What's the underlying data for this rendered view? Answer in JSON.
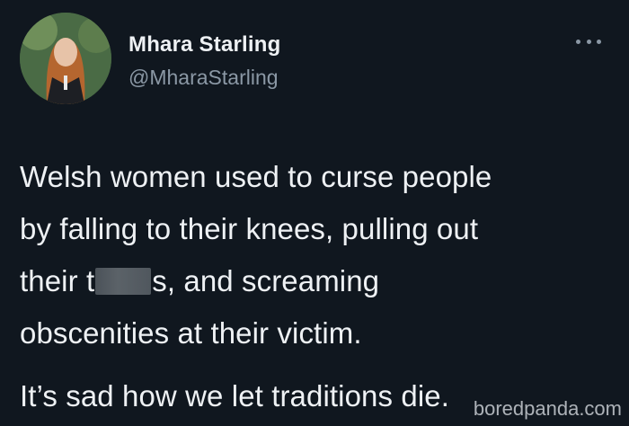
{
  "user": {
    "display_name": "Mhara Starling",
    "handle": "@MharaStarling"
  },
  "menu": {
    "icon": "more-horizontal-icon"
  },
  "tweet": {
    "line1": "Welsh women used to curse people",
    "line2": "by falling to their knees, pulling out",
    "line3_before": "their t",
    "line3_after": "s, and screaming",
    "line4": "obscenities at their victim.",
    "line5": "It’s sad how we let traditions die."
  },
  "watermark": "boredpanda.com"
}
